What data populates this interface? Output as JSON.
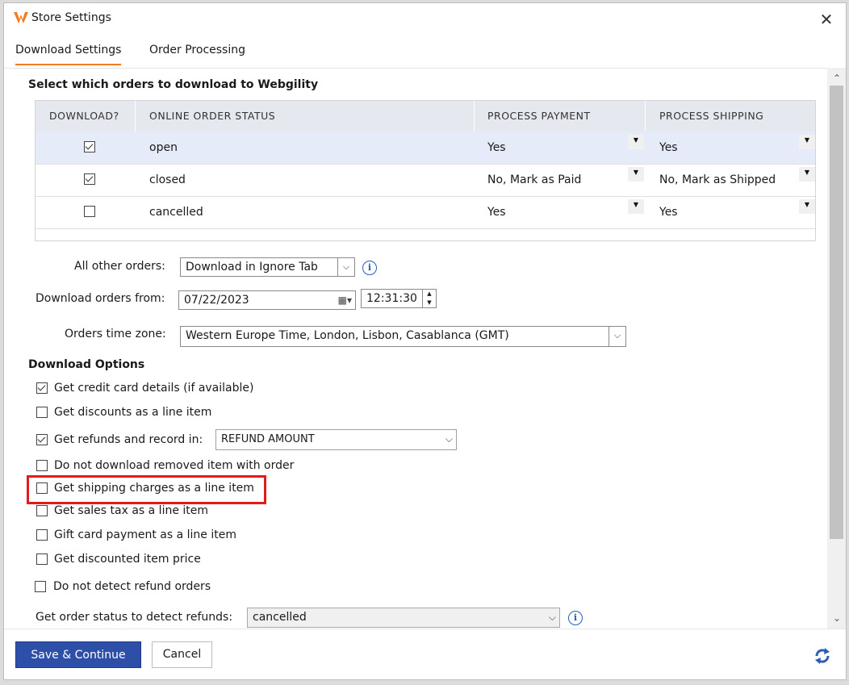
{
  "window": {
    "title": "Store Settings"
  },
  "tabs": [
    {
      "label": "Download Settings",
      "active": true
    },
    {
      "label": "Order Processing",
      "active": false
    }
  ],
  "orders_section": {
    "title": "Select which orders to download to Webgility",
    "columns": [
      "DOWNLOAD?",
      "ONLINE ORDER STATUS",
      "PROCESS PAYMENT",
      "PROCESS SHIPPING"
    ],
    "rows": [
      {
        "download": true,
        "status": "open",
        "payment": "Yes",
        "shipping": "Yes",
        "selected": true
      },
      {
        "download": true,
        "status": "closed",
        "payment": "No, Mark as Paid",
        "shipping": "No, Mark as Shipped",
        "selected": false
      },
      {
        "download": false,
        "status": "cancelled",
        "payment": "Yes",
        "shipping": "Yes",
        "selected": false
      }
    ]
  },
  "form": {
    "all_other_orders_label": "All other orders:",
    "all_other_orders_value": "Download in Ignore Tab",
    "download_from_label": "Download orders from:",
    "download_from_date": "07/22/2023",
    "download_from_time": "12:31:30",
    "timezone_label": "Orders time zone:",
    "timezone_value": "Western Europe Time, London, Lisbon, Casablanca (GMT)"
  },
  "download_options": {
    "title": "Download Options",
    "items": [
      {
        "label": "Get credit card details (if available)",
        "checked": true
      },
      {
        "label": "Get discounts as a line item",
        "checked": false
      },
      {
        "label": "Get refunds and record in:",
        "checked": true,
        "select_value": "REFUND AMOUNT"
      },
      {
        "label": "Do not download removed item with order",
        "checked": false
      },
      {
        "label": "Get shipping charges as a line item",
        "checked": false,
        "highlighted": true
      },
      {
        "label": "Get sales tax as a line item",
        "checked": false
      },
      {
        "label": "Gift card payment as a line item",
        "checked": false
      },
      {
        "label": "Get discounted item price",
        "checked": false
      },
      {
        "label": "Do not detect refund orders",
        "checked": false
      }
    ],
    "refund_status_label": "Get order status to detect refunds:",
    "refund_status_value": "cancelled"
  },
  "footer": {
    "save_label": "Save & Continue",
    "cancel_label": "Cancel"
  },
  "colors": {
    "accent": "#f47b20",
    "primary_button": "#2e4fa8",
    "highlight": "#e11a1a",
    "selected_row": "#e6ebfa"
  },
  "icons": [
    "webgility-logo-icon",
    "close-icon",
    "info-icon",
    "calendar-icon",
    "refresh-icon"
  ]
}
